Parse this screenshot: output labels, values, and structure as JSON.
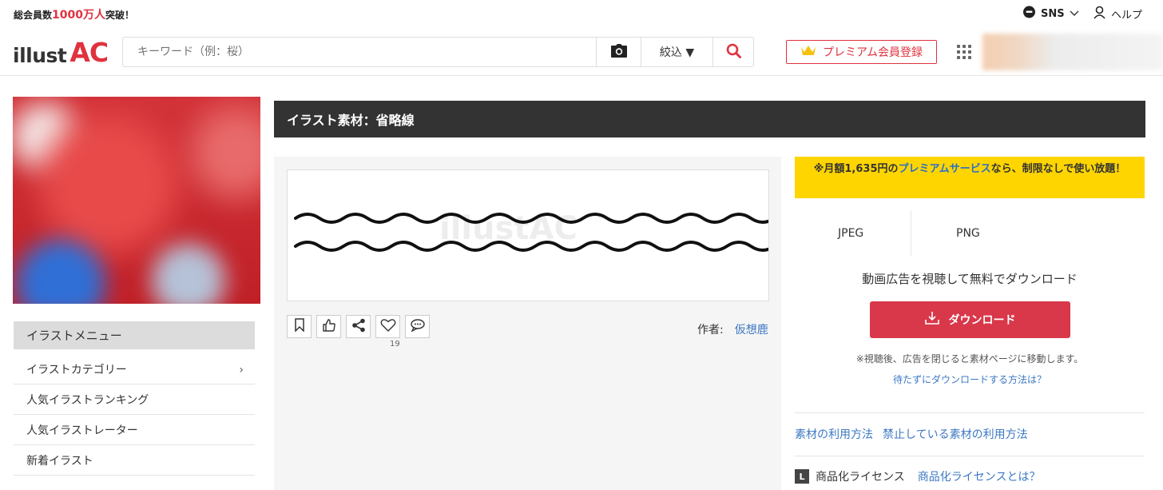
{
  "topbar": {
    "members_prefix": "総会員数",
    "members_count": "1000万人",
    "members_suffix": "突破！",
    "sns_label": "SNS",
    "help_label": "ヘルプ"
  },
  "header": {
    "logo_text": "illust",
    "logo_accent": "AC",
    "search_placeholder": "キーワード（例：桜）",
    "filter_label": "絞込 ▼",
    "premium_label": "プレミアム会員登録"
  },
  "sidebar": {
    "menu_title": "イラストメニュー",
    "items": [
      {
        "label": "イラストカテゴリー",
        "chevron": "›"
      },
      {
        "label": "人気イラストランキング"
      },
      {
        "label": "人気イラストレーター"
      },
      {
        "label": "新着イラスト"
      }
    ]
  },
  "main": {
    "title": "イラスト素材：省略線",
    "watermark": "illustAC",
    "like_count": "19",
    "author_label": "作者:",
    "author_name": "仮想鹿"
  },
  "download": {
    "promo_prefix": "※月額1,635円の",
    "promo_link": "プレミアムサービス",
    "promo_suffix": "なら、制限なしで使い放題！",
    "formats": [
      "JPEG",
      "PNG"
    ],
    "caption": "動画広告を視聴して無料でダウンロード",
    "button_label": "ダウンロード",
    "note": "※視聴後、広告を閉じると素材ページに移動します。",
    "wait_link": "待たずにダウンロードする方法は？",
    "usage_link": "素材の利用方法",
    "prohibited_link": "禁止している素材の利用方法",
    "license_badge": "L",
    "license_label": "商品化ライセンス",
    "license_link": "商品化ライセンスとは？"
  },
  "colors": {
    "brand_red": "#e0323e",
    "download_red": "#d8384a",
    "promo_yellow": "#ffd500",
    "link_blue": "#3c78c3",
    "title_bar": "#333333"
  },
  "icons": [
    "chat-bubble-icon",
    "chevron-down-icon",
    "user-icon",
    "camera-icon",
    "search-icon",
    "crown-icon",
    "apps-grid-icon",
    "bookmark-icon",
    "thumbs-up-icon",
    "share-icon",
    "heart-icon",
    "comment-icon",
    "download-icon"
  ]
}
